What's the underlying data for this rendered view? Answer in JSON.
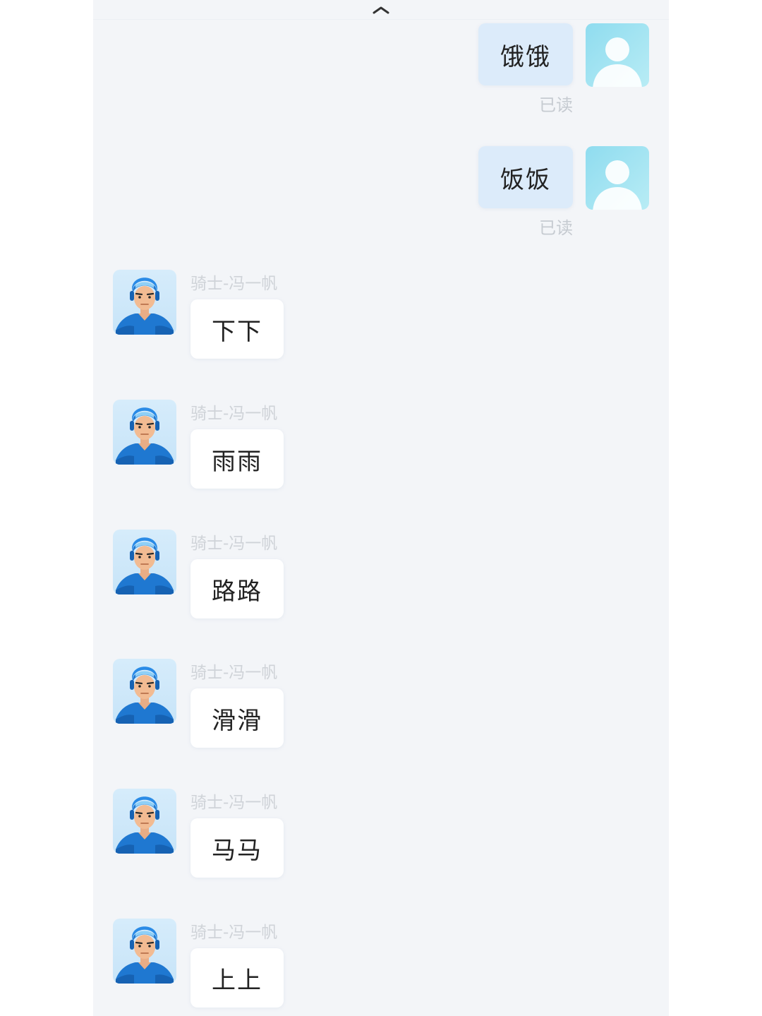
{
  "header": {
    "collapse_icon": "chevron-up-icon"
  },
  "outgoing_messages": [
    {
      "text": "饿饿",
      "status": "已读",
      "avatar_icon": "default-user-avatar-icon"
    },
    {
      "text": "饭饭",
      "status": "已读",
      "avatar_icon": "default-user-avatar-icon"
    }
  ],
  "incoming_messages": [
    {
      "sender": "骑士-冯一帆",
      "text": "下下",
      "avatar_icon": "rider-avatar-icon"
    },
    {
      "sender": "骑士-冯一帆",
      "text": "雨雨",
      "avatar_icon": "rider-avatar-icon"
    },
    {
      "sender": "骑士-冯一帆",
      "text": "路路",
      "avatar_icon": "rider-avatar-icon"
    },
    {
      "sender": "骑士-冯一帆",
      "text": "滑滑",
      "avatar_icon": "rider-avatar-icon"
    },
    {
      "sender": "骑士-冯一帆",
      "text": "马马",
      "avatar_icon": "rider-avatar-icon"
    },
    {
      "sender": "骑士-冯一帆",
      "text": "上上",
      "avatar_icon": "rider-avatar-icon"
    }
  ],
  "colors": {
    "background": "#f3f5f8",
    "outgoing_bubble": "#dcebfa",
    "incoming_bubble": "#ffffff",
    "rider_uniform": "#1f78d1",
    "muted_text": "#cfd3d8"
  }
}
